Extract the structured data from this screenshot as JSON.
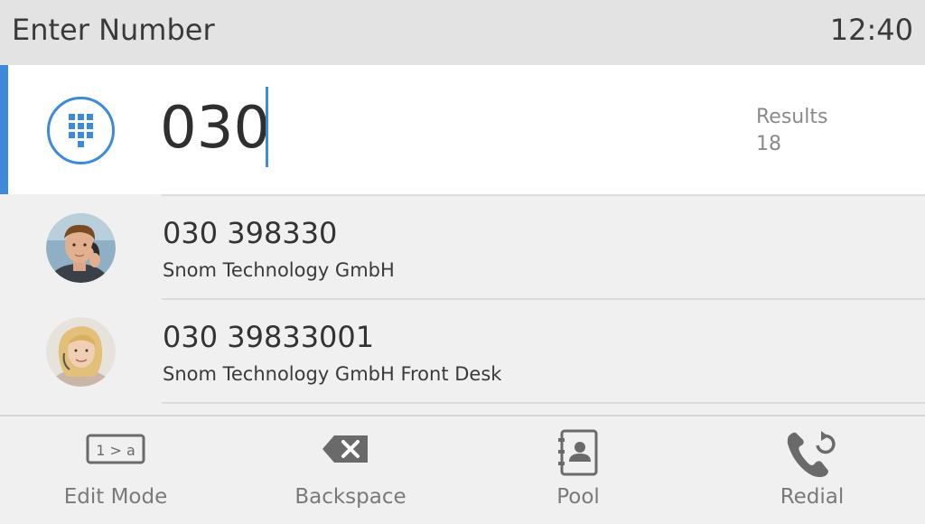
{
  "header": {
    "title": "Enter Number",
    "clock": "12:40"
  },
  "entry": {
    "dialpad_icon": "dialpad-icon",
    "value": "030",
    "results_label": "Results",
    "results_count": "18"
  },
  "contacts": [
    {
      "number": "030 398330",
      "name": "Snom Technology GmbH"
    },
    {
      "number": "030 39833001",
      "name": "Snom Technology GmbH Front Desk"
    }
  ],
  "softkeys": [
    {
      "label": "Edit Mode",
      "icon": "edit-mode-icon",
      "icon_text": "1 > a"
    },
    {
      "label": "Backspace",
      "icon": "backspace-icon"
    },
    {
      "label": "Pool",
      "icon": "address-book-icon"
    },
    {
      "label": "Redial",
      "icon": "redial-icon"
    }
  ],
  "colors": {
    "accent": "#3d8bd6",
    "header_bg": "#e3e3e3",
    "body_bg": "#f0f0f0"
  }
}
